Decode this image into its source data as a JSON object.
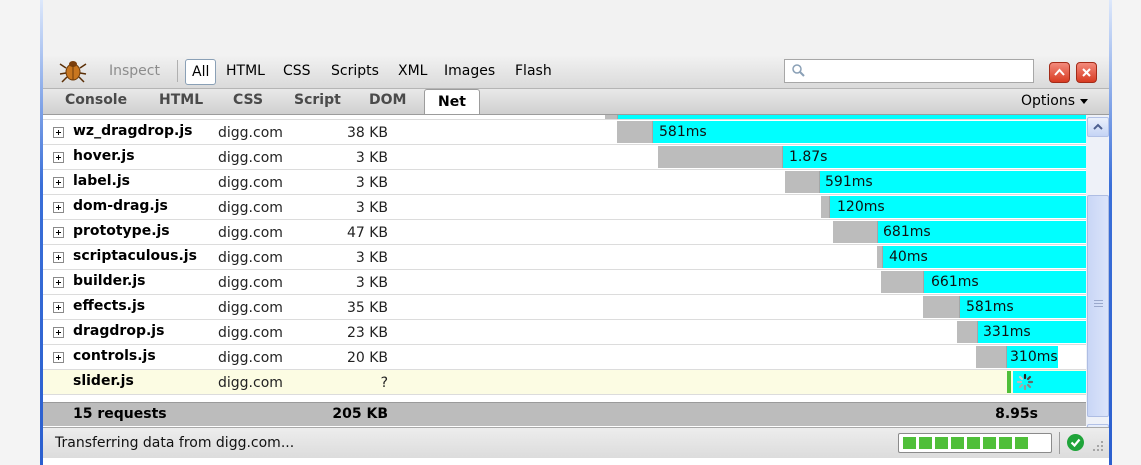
{
  "toolbar": {
    "inspect_label": "Inspect",
    "filters": [
      "All",
      "HTML",
      "CSS",
      "Scripts",
      "XML",
      "Images",
      "Flash"
    ],
    "active_filter": "All",
    "search_value": ""
  },
  "tabs": {
    "items": [
      "Console",
      "HTML",
      "CSS",
      "Script",
      "DOM",
      "Net"
    ],
    "active": "Net",
    "options_label": "Options"
  },
  "net": {
    "requests": [
      {
        "name": "wz_dragdrop.js",
        "domain": "digg.com",
        "size": "38 KB",
        "time": "581ms",
        "expandable": true
      },
      {
        "name": "hover.js",
        "domain": "digg.com",
        "size": "3 KB",
        "time": "1.87s",
        "expandable": true
      },
      {
        "name": "label.js",
        "domain": "digg.com",
        "size": "3 KB",
        "time": "591ms",
        "expandable": true
      },
      {
        "name": "dom-drag.js",
        "domain": "digg.com",
        "size": "3 KB",
        "time": "120ms",
        "expandable": true
      },
      {
        "name": "prototype.js",
        "domain": "digg.com",
        "size": "47 KB",
        "time": "681ms",
        "expandable": true
      },
      {
        "name": "scriptaculous.js",
        "domain": "digg.com",
        "size": "3 KB",
        "time": "40ms",
        "expandable": true
      },
      {
        "name": "builder.js",
        "domain": "digg.com",
        "size": "3 KB",
        "time": "661ms",
        "expandable": true
      },
      {
        "name": "effects.js",
        "domain": "digg.com",
        "size": "35 KB",
        "time": "581ms",
        "expandable": true
      },
      {
        "name": "dragdrop.js",
        "domain": "digg.com",
        "size": "23 KB",
        "time": "331ms",
        "expandable": true
      },
      {
        "name": "controls.js",
        "domain": "digg.com",
        "size": "20 KB",
        "time": "310ms",
        "expandable": true
      },
      {
        "name": "slider.js",
        "domain": "digg.com",
        "size": "?",
        "time": "",
        "expandable": false,
        "loading": true
      }
    ],
    "summary": {
      "requests": "15 requests",
      "total_size": "205 KB",
      "total_time": "8.95s"
    }
  },
  "status": {
    "text": "Transferring data from digg.com...",
    "progress_segments_filled": 8,
    "progress_segments_total": 8
  },
  "colors": {
    "load_bar": "#00ffff",
    "wait_bar": "#bcbcbc",
    "progress": "#4fbf39"
  }
}
